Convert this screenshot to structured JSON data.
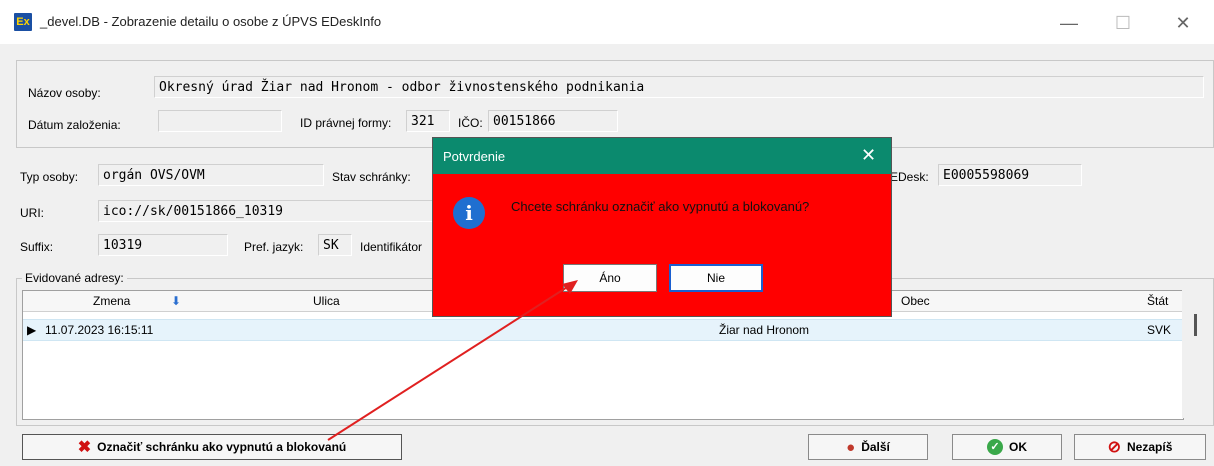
{
  "window": {
    "app_icon": "Ex",
    "title": "_devel.DB - Zobrazenie detailu o osobe z ÚPVS EDeskInfo",
    "minimize": "—",
    "maximize": "☐",
    "close": "✕"
  },
  "form": {
    "nazov_label": "Názov osoby:",
    "nazov_value": "Okresný úrad Žiar nad Hronom - odbor živnostenského podnikania",
    "datum_label": "Dátum založenia:",
    "datum_value": "",
    "id_pravnej_label": "ID právnej formy:",
    "id_pravnej_value": "321",
    "ico_label": "IČO:",
    "ico_value": "00151866",
    "typ_label": "Typ osoby:",
    "typ_value": "orgán OVS/OVM",
    "stav_label": "Stav schránky:",
    "edesk_label": "EDesk:",
    "edesk_value": "E0005598069",
    "uri_label": "URI:",
    "uri_value": "ico://sk/00151866_10319",
    "suffix_label": "Suffix:",
    "suffix_value": "10319",
    "pref_label": "Pref. jazyk:",
    "pref_value": "SK",
    "ident_label": "Identifikátor"
  },
  "addresses": {
    "legend": "Evidované adresy:",
    "columns": [
      "Zmena",
      "Ulica",
      "Obec",
      "Štát"
    ],
    "rows": [
      {
        "zmena": "11.07.2023 16:15:11",
        "ulica": "",
        "obec": "Žiar nad Hronom",
        "stat": "SVK"
      }
    ]
  },
  "buttons": {
    "mark": "Označiť schránku ako vypnutú a blokovanú",
    "next": "Ďalší",
    "ok": "OK",
    "cancel": "Nezapíš"
  },
  "dialog": {
    "title": "Potvrdenie",
    "close": "✕",
    "icon": "i",
    "message": "Chcete schránku označiť ako vypnutú a blokovanú?",
    "yes": "Áno",
    "no": "Nie"
  },
  "colors": {
    "dialog_bg": "#ff0000",
    "dialog_title_bg": "#0b8a6e",
    "arrow": "#e02020"
  }
}
